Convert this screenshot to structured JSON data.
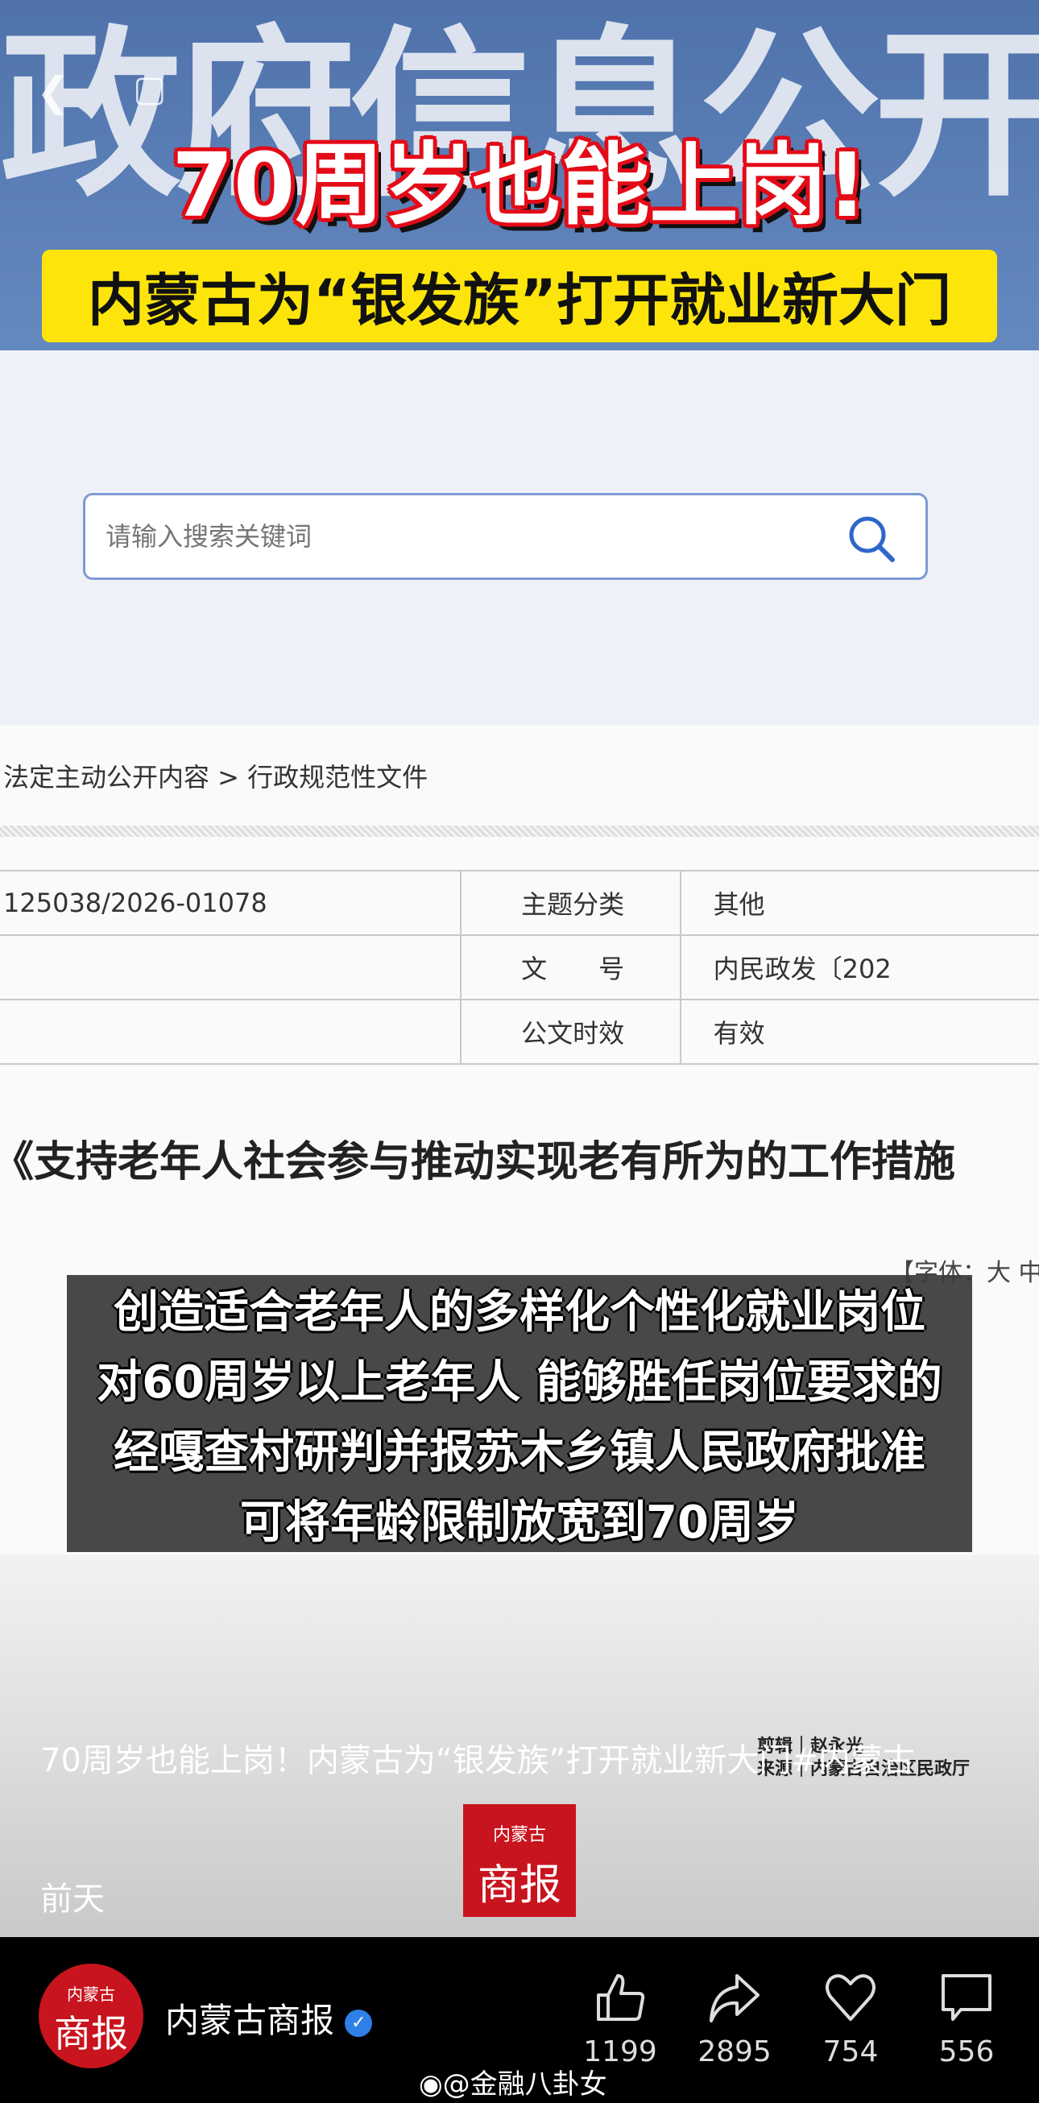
{
  "banner": {
    "bg_text": "政府信息公开",
    "headline": "70周岁也能上岗!",
    "subheadline": "内蒙古为“银发族”打开就业新大门"
  },
  "search": {
    "placeholder": "请输入搜索关键词"
  },
  "breadcrumb": {
    "text": "法定主动公开内容 > 行政规范性文件"
  },
  "table": {
    "rows": [
      {
        "value": "125038/2026-01078",
        "label": "主题分类",
        "label_value": "其他"
      },
      {
        "value": "",
        "label": "文　　号",
        "label_value": "内民政发〔202"
      },
      {
        "value": "",
        "label": "公文时效",
        "label_value": "有效"
      }
    ]
  },
  "document": {
    "title": "《支持老年人社会参与推动实现老有所为的工作措施",
    "font_size_control": "【字体：大  中"
  },
  "subtitle_overlay": [
    "创造适合老年人的多样化个性化就业岗位",
    "对60周岁以上老年人  能够胜任岗位要求的",
    "经嘎查村研判并报苏木乡镇人民政府批准",
    "可将年龄限制放宽到70周岁"
  ],
  "credits": {
    "editor": "剪辑｜赵永光",
    "source": "来源｜内蒙古自治区民政厅"
  },
  "post": {
    "caption": "70周岁也能上岗！内蒙古为“银发族”打开就业新大门#内蒙古",
    "time": "前天"
  },
  "logo": {
    "top": "内蒙古",
    "bottom": "商报"
  },
  "account": {
    "name": "内蒙古商报",
    "verified": true
  },
  "actions": {
    "like": "1199",
    "share": "2895",
    "favorite": "754",
    "comment": "556"
  },
  "watermark": "@金融八卦女",
  "colors": {
    "banner": "#5a7fb7",
    "headline_outline": "#e30b17",
    "yellow": "#fde50b",
    "brand_red": "#c8141e",
    "verified": "#2f7fe8"
  }
}
